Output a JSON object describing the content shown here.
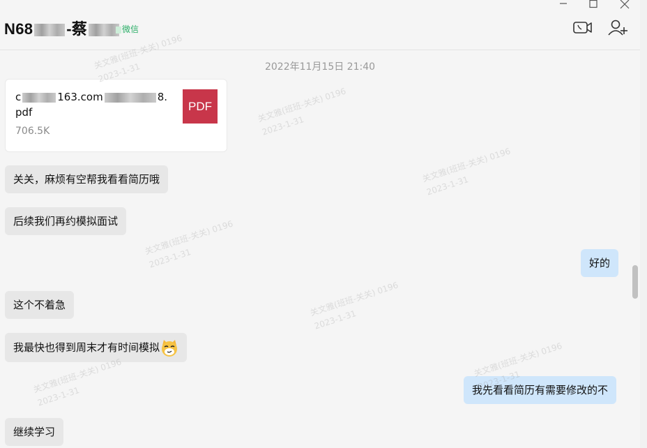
{
  "header": {
    "title_prefix": "N68",
    "title_mid": "-蔡",
    "account_tag": "微信",
    "icons": [
      "video-call-icon",
      "add-member-icon"
    ],
    "window_controls": [
      "minimize-icon",
      "maximize-icon",
      "close-icon"
    ]
  },
  "chat": {
    "timestamp": "2022年11月15日 21:40",
    "file": {
      "name_start": "c",
      "name_mid": "163.com",
      "name_end": "8.",
      "name_line2": "pdf",
      "size": "706.5K",
      "type_label": "PDF"
    },
    "messages": [
      {
        "side": "left",
        "text": "关关，麻烦有空帮我看看简历哦"
      },
      {
        "side": "left",
        "text": "后续我们再约模拟面试"
      },
      {
        "side": "right",
        "text": "好的"
      },
      {
        "side": "left",
        "text": "这个不着急"
      },
      {
        "side": "left",
        "text": "我最快也得到周末才有时间模拟",
        "emoji": "smirk-cat-emoji"
      },
      {
        "side": "right",
        "text": "我先看看简历有需要修改的不"
      },
      {
        "side": "left",
        "text": "继续学习"
      }
    ]
  },
  "watermark": {
    "line1": "关文雅(班班-关关) 0196",
    "line2": "2023-1-31"
  },
  "colors": {
    "background": "#f5f5f5",
    "bubble_left": "#e7e7e7",
    "bubble_right": "#cfe6fb",
    "pdf_icon": "#c8364a",
    "wechat_green": "#2aae67"
  }
}
